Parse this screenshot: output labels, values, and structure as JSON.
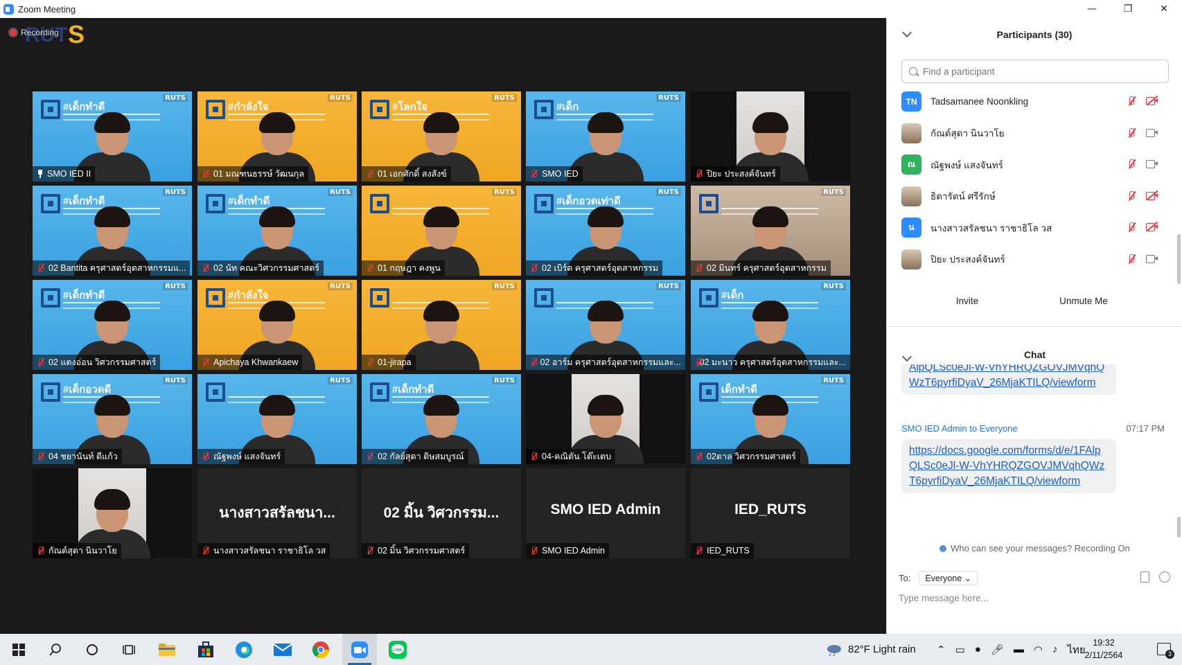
{
  "window": {
    "title": "Zoom Meeting",
    "minimize": "—",
    "restore": "❐",
    "close": "✕"
  },
  "recording": {
    "label": "Recording"
  },
  "tiles": [
    {
      "label": "SMO IED II",
      "muted": false,
      "pinned": true,
      "active": true,
      "style": "blue",
      "poster": "#เด็กทำดี"
    },
    {
      "label": "01 มณฑนธรรษ์ วัฒนกุล",
      "muted": true,
      "style": "orange",
      "poster": "#กำลังใจ"
    },
    {
      "label": "01 เอกศักดิ์ สงสังข์",
      "muted": true,
      "style": "orange",
      "poster": "#โลกใจ"
    },
    {
      "label": "SMO IED",
      "muted": true,
      "style": "blue",
      "poster": "#เด็ก"
    },
    {
      "label": "ปิยะ ประสงค์จันทร์",
      "muted": true,
      "style": "wall",
      "poster": ""
    },
    {
      "label": "02 Bantita ครุศาสตร์อุตสาหกรรมแ...",
      "muted": true,
      "style": "blue",
      "poster": "#เด็กทำดี"
    },
    {
      "label": "02 นัท คณะวิศวกรรมศาสตร์",
      "muted": true,
      "style": "blue",
      "poster": "#เด็กทำดี"
    },
    {
      "label": "01 กฤษฎา คงพูน",
      "muted": true,
      "style": "orange",
      "poster": ""
    },
    {
      "label": "02 เบิร์ด ครุศาสตร์อุตสาหกรรม",
      "muted": true,
      "style": "blue",
      "poster": "#เด็กอวดเท่าดี"
    },
    {
      "label": "02 มินทร์ ครุศาสตร์อุตสาหกรรม",
      "muted": true,
      "style": "room",
      "poster": ""
    },
    {
      "label": "02 แตงอ่อน วิศวกรรมศาสตร์",
      "muted": true,
      "style": "blue",
      "poster": "#เด็กทำดี"
    },
    {
      "label": "Apichaya Khwankaew",
      "muted": true,
      "style": "orange",
      "poster": "#กำลังใจ"
    },
    {
      "label": "01-jirapa",
      "muted": true,
      "style": "orange",
      "poster": ""
    },
    {
      "label": "02 อาร์ม ครุศาสตร์อุตสาหกรรมและ...",
      "muted": true,
      "style": "blue",
      "poster": ""
    },
    {
      "label": "02 มะนาว ครุศาสตร์อุตสาหกรรมและ...",
      "muted": true,
      "style": "blue",
      "poster": "#เด็ก"
    },
    {
      "label": "04 ชยานันท์ ดีแก้ว",
      "muted": true,
      "style": "blue",
      "poster": "#เด็กอวดดี"
    },
    {
      "label": "ณัฐพงษ์ แสงจันทร์",
      "muted": true,
      "style": "blue",
      "poster": ""
    },
    {
      "label": "02 กัลย์สุดา ดิษสมบูรณ์",
      "muted": true,
      "style": "blue",
      "poster": "#เด็กทำดี"
    },
    {
      "label": "04-คณิตัน โต๊ะเตบ",
      "muted": true,
      "style": "wall",
      "poster": ""
    },
    {
      "label": "02ตาล วิศวกรรมศาสตร์",
      "muted": true,
      "style": "blue",
      "poster": "เด็กทำดี"
    },
    {
      "label": "กัณต์สุดา นินวาโย",
      "muted": true,
      "style": "wall",
      "poster": ""
    },
    {
      "label": "นางสาวสรัลชนา ราชาธิโล วส",
      "muted": true,
      "style": "name",
      "bigname": "นางสาวสรัลชนา..."
    },
    {
      "label": "02 มิ้น วิศวกรรมศาสตร์",
      "muted": true,
      "style": "name",
      "bigname": "02 มิ้น วิศวกรรม..."
    },
    {
      "label": "SMO IED Admin",
      "muted": true,
      "style": "name",
      "bigname": "SMO IED Admin"
    },
    {
      "label": "IED_RUTS",
      "muted": true,
      "style": "name",
      "bigname": "IED_RUTS"
    }
  ],
  "panel": {
    "participants_title": "Participants (30)",
    "search_placeholder": "Find a participant",
    "participants": [
      {
        "name": "Tadsamanee Noonkling",
        "initials": "TN",
        "avatar_color": "#2d8cff",
        "cam_off": true
      },
      {
        "name": "กัณต์สุดา นินวาโย",
        "initials": "",
        "avatar_color": "",
        "cam_off": false
      },
      {
        "name": "ณัฐพงษ์ แสงจันทร์",
        "initials": "ณ",
        "avatar_color": "#2fb35c",
        "cam_off": false
      },
      {
        "name": "ธิดารัตน์ ศรีรักษ์",
        "initials": "",
        "avatar_color": "",
        "cam_off": true
      },
      {
        "name": "นางสาวสรัลชนา ราชาธิโล วส",
        "initials": "น",
        "avatar_color": "#2d8cff",
        "cam_off": true
      },
      {
        "name": "ปิยะ ประสงค์จันทร์",
        "initials": "",
        "avatar_color": "",
        "cam_off": false
      }
    ],
    "invite_label": "Invite",
    "unmute_label": "Unmute Me",
    "chat_title": "Chat",
    "chat": {
      "partial_link": "AlpQLSc0eJl-W-VhYHRQZGOVJMVqhQWzT6pyrfiDyaV_26MjaKTILQ/viewform",
      "sender": "SMO IED Admin",
      "to_text": "to Everyone",
      "time": "07:17 PM",
      "link": "https://docs.google.com/forms/d/e/1FAlpQLSc0eJl-W-VhYHRQZGOVJMVqhQWzT6pyrfiDyaV_26MjaKTILQ/viewform"
    },
    "privacy_text": "Who can see your messages? Recording On",
    "to_label": "To:",
    "to_value": "Everyone ⌄",
    "message_placeholder": "Type message here..."
  },
  "taskbar": {
    "weather": "82°F  Light rain",
    "lang": "ไทย",
    "time": "19:32",
    "date": "2/11/2564",
    "notif_count": "3",
    "icons": [
      "windows-icon",
      "search-icon",
      "cortana-icon",
      "task-view-icon",
      "file-explorer-icon",
      "store-icon",
      "edge-icon",
      "mail-icon",
      "chrome-icon",
      "zoom-icon",
      "line-icon"
    ]
  }
}
